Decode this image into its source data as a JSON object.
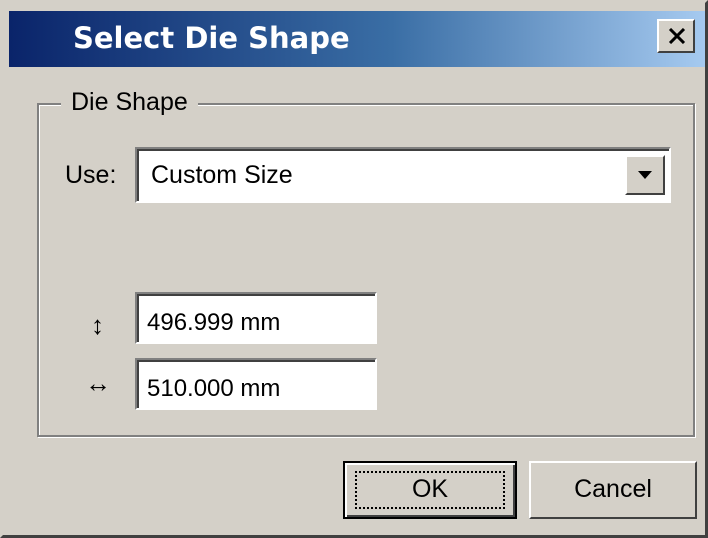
{
  "window": {
    "title": "Select Die Shape",
    "close_icon": "close-icon"
  },
  "group": {
    "legend": "Die Shape",
    "use_label": "Use:",
    "use_value": "Custom Size"
  },
  "dimensions": {
    "height_icon": "↕",
    "height_value": "496.999 mm",
    "width_icon": "↔",
    "width_value": "510.000 mm"
  },
  "buttons": {
    "ok": "OK",
    "cancel": "Cancel"
  },
  "colors": {
    "title_start": "#0a246a",
    "title_end": "#a6caf0",
    "face": "#d4d0c8"
  }
}
